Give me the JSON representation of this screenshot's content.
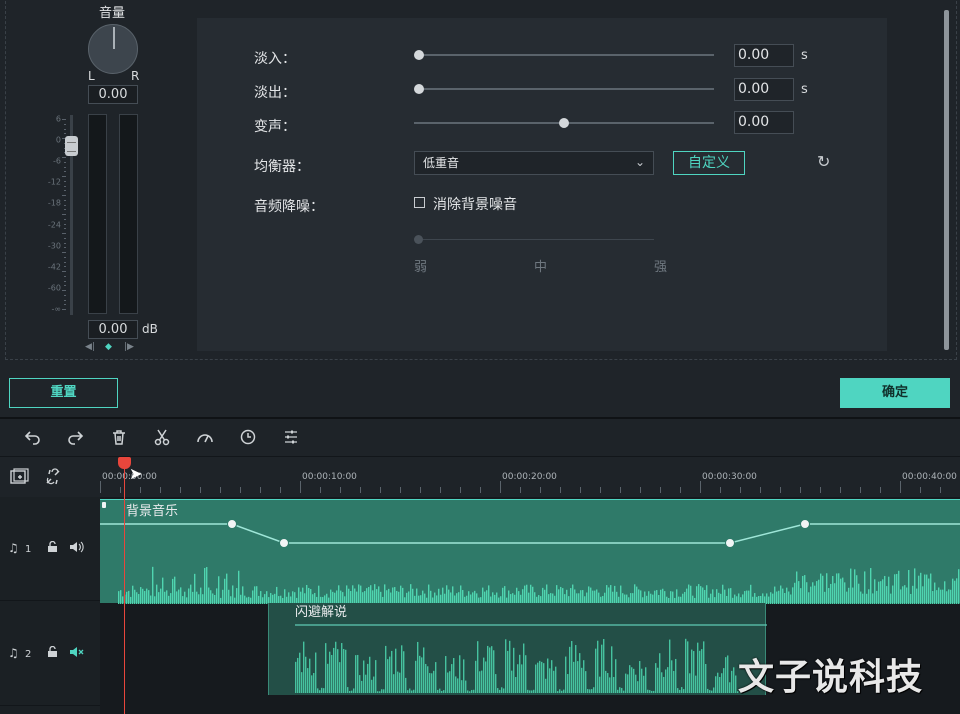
{
  "volume": {
    "title": "音量",
    "l": "L",
    "r": "R",
    "value": "0.00",
    "db_value": "0.00",
    "db_unit": "dB",
    "scale": [
      "6",
      "0",
      "-6",
      "-12",
      "-18",
      "-24",
      "-30",
      "-42",
      "-60",
      "-∞"
    ],
    "balance": {
      "left": "◀|",
      "center": "◆",
      "right": "|▶"
    }
  },
  "settings": {
    "fade_in": {
      "label": "淡入：",
      "value": "0.00",
      "unit": "s",
      "level": 0
    },
    "fade_out": {
      "label": "淡出：",
      "value": "0.00",
      "unit": "s",
      "level": 0
    },
    "pitch": {
      "label": "变声：",
      "value": "0.00",
      "level": 0.5
    },
    "equalizer": {
      "label": "均衡器：",
      "selected": "低重音",
      "custom_label": "自定义"
    },
    "denoise": {
      "label": "音频降噪：",
      "checkbox_label": "消除背景噪音",
      "checked": false,
      "levels": [
        "弱",
        "中",
        "强"
      ],
      "level": 0
    }
  },
  "buttons": {
    "reset": "重置",
    "ok": "确定"
  },
  "toolbar": {
    "icons": [
      "undo-icon",
      "redo-icon",
      "delete-icon",
      "cut-icon",
      "speed-icon",
      "duration-icon",
      "adjust-icon"
    ]
  },
  "ruler": {
    "labels": [
      "00:00:00:00",
      "00:00:10:00",
      "00:00:20:00",
      "00:00:30:00",
      "00:00:40:00"
    ]
  },
  "tracks": [
    {
      "number": "1",
      "clip_title": "背景音乐"
    },
    {
      "number": "2",
      "clip_title": "闪避解说"
    }
  ],
  "watermark": "文子说科技",
  "colors": {
    "accent": "#4fd5c1",
    "playhead": "#e8463c"
  }
}
